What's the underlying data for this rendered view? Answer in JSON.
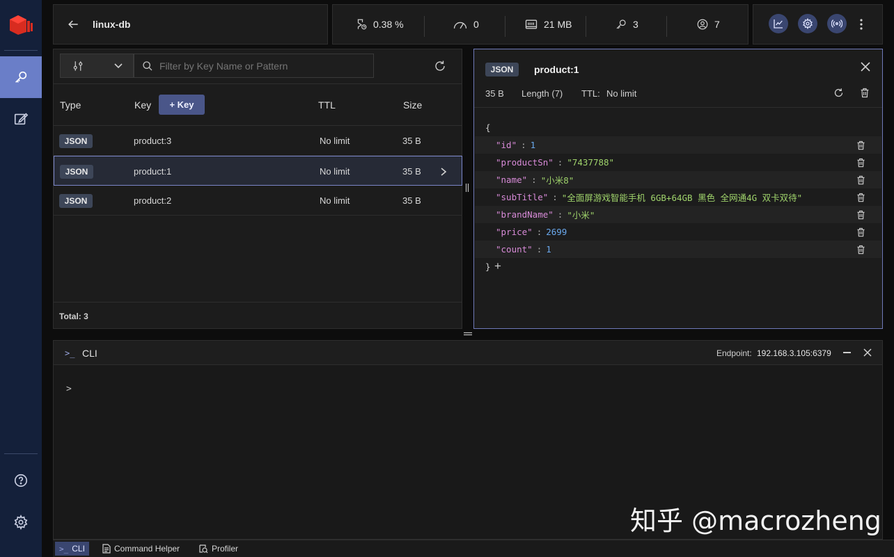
{
  "header": {
    "db_name": "linux-db",
    "stats": {
      "cpu": "0.38 %",
      "ops": "0",
      "memory": "21 MB",
      "keys": "3",
      "clients": "7"
    }
  },
  "browser": {
    "filter_placeholder": "Filter by Key Name or Pattern",
    "columns": {
      "type": "Type",
      "key": "Key",
      "add_key": "+ Key",
      "ttl": "TTL",
      "size": "Size"
    },
    "rows": [
      {
        "type": "JSON",
        "key": "product:3",
        "ttl": "No limit",
        "size": "35 B"
      },
      {
        "type": "JSON",
        "key": "product:1",
        "ttl": "No limit",
        "size": "35 B"
      },
      {
        "type": "JSON",
        "key": "product:2",
        "ttl": "No limit",
        "size": "35 B"
      }
    ],
    "total": "Total: 3"
  },
  "details": {
    "type": "JSON",
    "key": "product:1",
    "size": "35 B",
    "length": "Length (7)",
    "ttl_label": "TTL:",
    "ttl_value": "No limit",
    "open_brace": "{",
    "close_brace": "}",
    "add": "+",
    "fields": [
      {
        "key": "\"id\"",
        "value": "1",
        "kind": "number"
      },
      {
        "key": "\"productSn\"",
        "value": "\"7437788\"",
        "kind": "string"
      },
      {
        "key": "\"name\"",
        "value": "\"小米8\"",
        "kind": "string"
      },
      {
        "key": "\"subTitle\"",
        "value": "\"全面屏游戏智能手机 6GB+64GB 黑色 全网通4G 双卡双待\"",
        "kind": "string"
      },
      {
        "key": "\"brandName\"",
        "value": "\"小米\"",
        "kind": "string"
      },
      {
        "key": "\"price\"",
        "value": "2699",
        "kind": "number"
      },
      {
        "key": "\"count\"",
        "value": "1",
        "kind": "number"
      }
    ],
    "colon": ":"
  },
  "cli": {
    "title": "CLI",
    "endpoint_label": "Endpoint:",
    "endpoint_value": "192.168.3.105:6379",
    "prompt": ">",
    "watermark": "知乎 @macrozheng"
  },
  "bottom_tabs": {
    "cli": "CLI",
    "command_helper": "Command Helper",
    "profiler": "Profiler"
  },
  "colors": {
    "sidebar": "#14203a",
    "accent": "#6a7ec8",
    "json_key": "#d78ad7",
    "json_string": "#9fd36b",
    "json_number": "#6aa9ee"
  }
}
